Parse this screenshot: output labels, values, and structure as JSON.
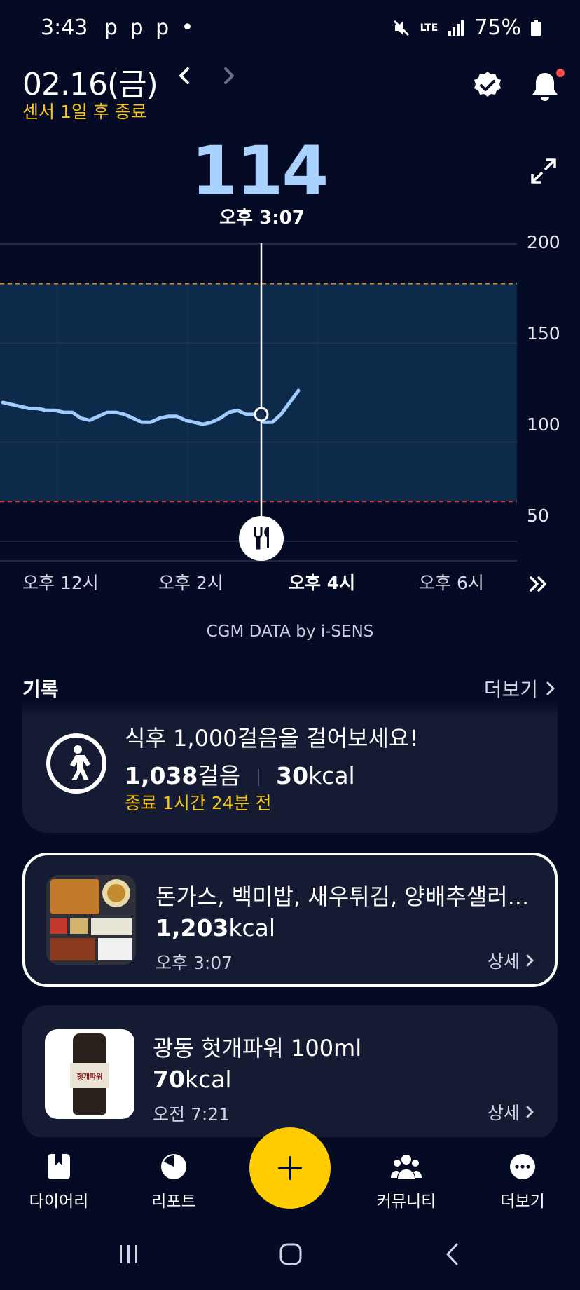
{
  "status_bar": {
    "time": "3:43",
    "notifications": "p p p •",
    "network_top": "LTE",
    "battery": "75%"
  },
  "header": {
    "date": "02.16(금)",
    "sensor_note": "센서 1일 후 종료",
    "icons": [
      "chevron-left-icon",
      "chevron-right-icon",
      "verified-badge-icon",
      "bell-icon",
      "expand-icon"
    ]
  },
  "glucose": {
    "value": "114",
    "time": "오후 3:07"
  },
  "chart_data": {
    "type": "line",
    "y_ticks": [
      "200",
      "150",
      "100",
      "50"
    ],
    "ylim": [
      40,
      200
    ],
    "x_ticks": [
      "오후 12시",
      "오후 2시",
      "오후 4시",
      "오후 6시"
    ],
    "target_range": [
      70,
      180
    ],
    "series": [
      {
        "values": [
          120,
          119,
          118,
          117,
          117,
          116,
          116,
          115,
          115,
          112,
          111,
          113,
          115,
          115,
          114,
          112,
          110,
          110,
          112,
          113,
          113,
          111,
          110,
          109,
          110,
          112,
          115,
          116,
          114,
          114,
          110,
          110,
          114,
          120,
          126
        ]
      }
    ],
    "selected_point": 114,
    "meal_marker_icon": "fork-knife-icon",
    "colors": {
      "line": "#9fcbff",
      "range_fill": "#0e2a4a",
      "high_line": "#d08a28",
      "low_line": "#d8323c"
    }
  },
  "chart_nav_icon": "double-chevron-right-icon",
  "credit": "CGM DATA by i-SENS",
  "records": {
    "title": "기록",
    "more": "더보기",
    "activity": {
      "title": "식후 1,000걸음을 걸어보세요!",
      "steps_value": "1,038",
      "steps_unit": "걸음",
      "kcal_value": "30",
      "kcal_unit": "kcal",
      "ends": "종료 1시간 24분 전",
      "icon": "walking-person-icon"
    },
    "meals": [
      {
        "title": "돈가스, 백미밥, 새우튀김, 양배추샐러...",
        "kcal_value": "1,203",
        "kcal_unit": "kcal",
        "time": "오후 3:07",
        "detail": "상세"
      },
      {
        "title": "광동 헛개파워 100ml",
        "kcal_value": "70",
        "kcal_unit": "kcal",
        "time": "오전 7:21",
        "detail": "상세",
        "product_label": "헛개파워"
      }
    ]
  },
  "bottom_nav": {
    "items": [
      {
        "label": "다이어리",
        "icon": "book-icon"
      },
      {
        "label": "리포트",
        "icon": "pie-chart-icon"
      },
      {
        "label": "커뮤니티",
        "icon": "people-icon"
      },
      {
        "label": "더보기",
        "icon": "more-dots-icon"
      }
    ],
    "fab_icon": "plus-icon"
  }
}
